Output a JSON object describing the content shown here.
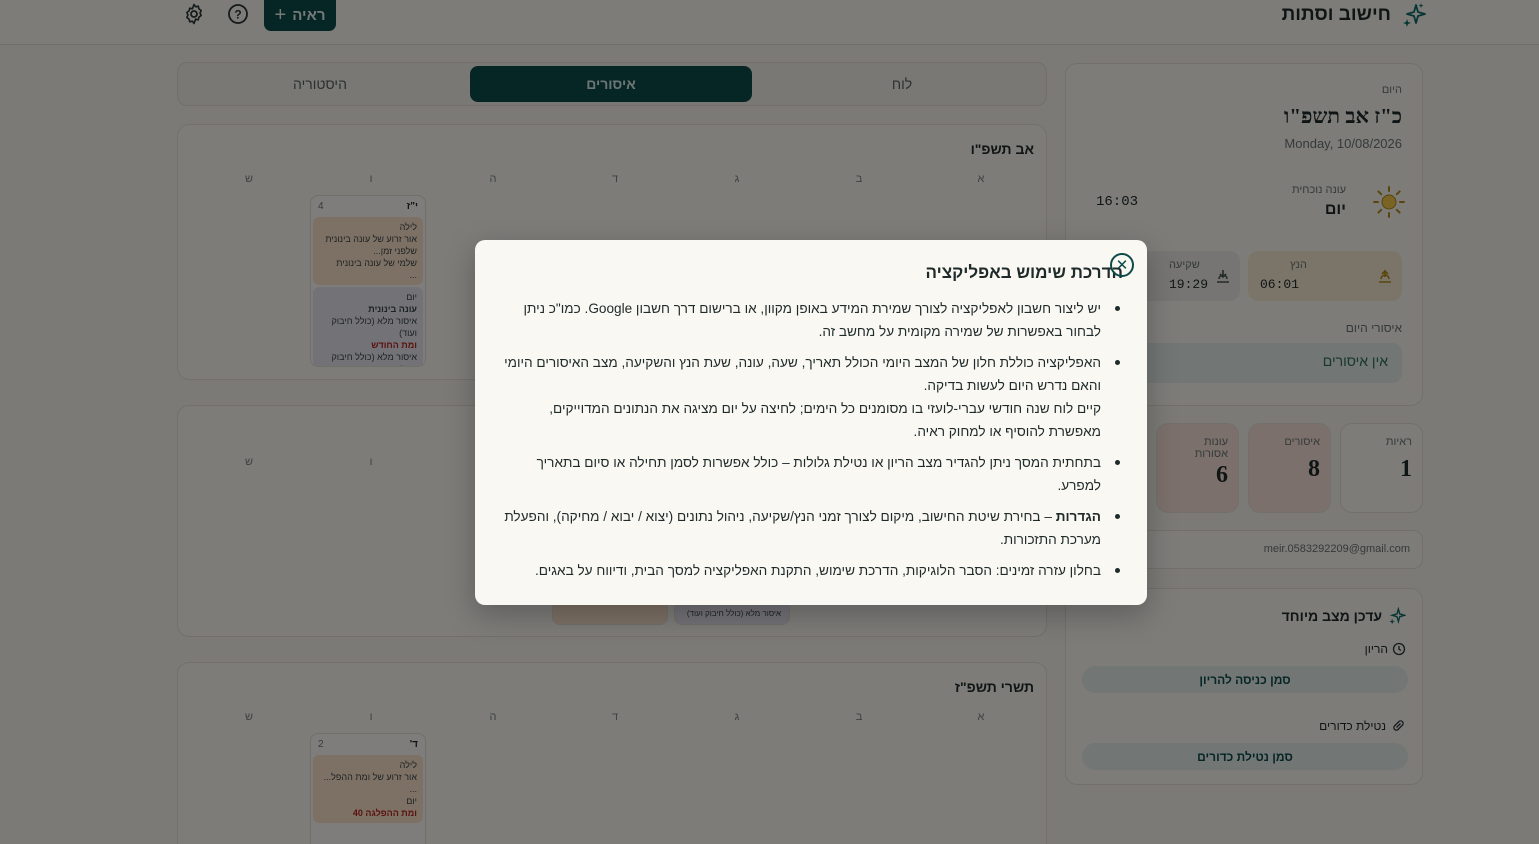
{
  "header": {
    "app_title": "חישוב וסתות",
    "add_button_label": "ראיה",
    "add_button_glyph": "+",
    "help_icon_glyph": "?"
  },
  "tabs": [
    {
      "label": "לוח"
    },
    {
      "label": "איסורים"
    },
    {
      "label": "היסטוריה"
    }
  ],
  "calendar": {
    "weekday_labels": [
      "א",
      "ב",
      "ג",
      "ד",
      "ה",
      "ו",
      "ש"
    ],
    "months": [
      {
        "title": "אב תשפ\"ו",
        "cell": {
          "heb_day": "י\"ז",
          "greg_day": "4",
          "lines": [
            "לילה",
            "אור זרוע של עונה בינונית",
            "שלפני זמן...",
            "שלמי של עונה בינונית",
            "...",
            "יום",
            "עונה בינונית",
            "איסור מלא (כולל חיבוק ועוד)",
            "ומת החודש",
            "איסור מלא (כולל חיבוק ועוד)"
          ]
        }
      },
      {
        "title": "",
        "cell": {
          "heb_day": "",
          "greg_day": "",
          "lines": [
            "איסור מלא (כולל חיבוק ועוד)"
          ]
        }
      },
      {
        "title": "תשרי תשפ\"ז",
        "cell": {
          "heb_day": "ד'",
          "greg_day": "2",
          "lines": [
            "לילה",
            "אור זרוע של ומת ההפל...",
            "...",
            "יום",
            "ומת ההפלגה 40"
          ]
        }
      }
    ]
  },
  "sidebar": {
    "today_label": "היום",
    "hebrew_date": "כ\"ז אב תשפ\"ו",
    "gregorian_date": "Monday, 10/08/2026",
    "current_time": "16:03",
    "onah_label": "עונה נוכחית",
    "onah_value": "יום",
    "sunrise_label": "הנץ",
    "sunrise_time": "06:01",
    "sunset_label": "שקיעה",
    "sunset_time": "19:29",
    "prohibitions_label": "איסורי היום",
    "prohibitions_value": "אין איסורים"
  },
  "stats": [
    {
      "label": "ראיות",
      "value": "1"
    },
    {
      "label": "איסורים",
      "value": "8"
    },
    {
      "label": "עונות אסורות",
      "value": "6"
    }
  ],
  "account": {
    "email": "meir.0583292209@gmail.com"
  },
  "special_state": {
    "title": "עדכן מצב מיוחד",
    "pregnancy_label": "הריון",
    "pregnancy_button": "סמן כניסה להריון",
    "pills_label": "נטילת כדורים",
    "pills_button": "סמן נטילת כדורים"
  },
  "modal": {
    "title": "הדרכת שימוש באפליקציה",
    "close_glyph": "✕",
    "items": [
      {
        "text": "יש ליצור חשבון לאפליקציה לצורך שמירת המידע באופן מקוון, או ברישום דרך חשבון Google. כמו\"כ ניתן לבחור באפשרות של שמירה מקומית על מחשב זה."
      },
      {
        "text": "האפליקציה כוללת חלון של המצב היומי הכולל תאריך, שעה, עונה, שעת הנץ והשקיעה, מצב האיסורים היומי והאם נדרש היום לעשות בדיקה.",
        "text2": "קיים לוח שנה חודשי עברי-לועזי בו מסומנים כל הימים; לחיצה על יום מציגה את הנתונים המדוייקים, מאפשרת להוסיף או למחוק ראיה."
      },
      {
        "text": "בתחתית המסך ניתן להגדיר מצב הריון או נטילת גלולות – כולל אפשרות לסמן תחילה או סיום בתאריך למפרע."
      },
      {
        "bold": "הגדרות",
        "text": " – בחירת שיטת החישוב, מיקום לצורך זמני הנץ/שקיעה, ניהול נתונים (יצוא / יבוא / מחיקה), והפעלת מערכת התזכורות."
      },
      {
        "text": "בחלון עזרה זמינים: הסבר הלוגיקות, הדרכת שימוש, התקנת האפליקציה למסך הבית, ודיווח על באגים."
      }
    ]
  }
}
